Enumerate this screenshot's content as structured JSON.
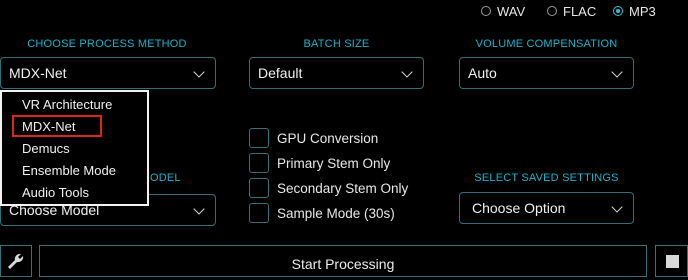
{
  "output_format": {
    "options": [
      {
        "label": "WAV",
        "selected": false
      },
      {
        "label": "FLAC",
        "selected": false
      },
      {
        "label": "MP3",
        "selected": true
      }
    ]
  },
  "process_method": {
    "header": "CHOOSE PROCESS METHOD",
    "value": "MDX-Net",
    "options": [
      "VR Architecture",
      "MDX-Net",
      "Demucs",
      "Ensemble Mode",
      "Audio Tools"
    ],
    "highlighted_option": "MDX-Net"
  },
  "batch_size": {
    "header": "BATCH SIZE",
    "value": "Default"
  },
  "volume_compensation": {
    "header": "VOLUME COMPENSATION",
    "value": "Auto"
  },
  "model": {
    "header_fragment": "ODEL",
    "value": "Choose Model"
  },
  "options": {
    "gpu_conversion": "GPU Conversion",
    "primary_stem_only": "Primary Stem Only",
    "secondary_stem_only": "Secondary Stem Only",
    "sample_mode": "Sample Mode (30s)"
  },
  "saved_settings": {
    "header": "SELECT SAVED SETTINGS",
    "value": "Choose Option"
  },
  "start_button": {
    "label": "Start Processing"
  },
  "icons": {
    "settings": "wrench-icon",
    "stop": "stop-icon"
  },
  "colors": {
    "accent": "#1ab1c9",
    "border": "#2f6f79",
    "highlight": "#e0241c",
    "background": "#000000"
  }
}
